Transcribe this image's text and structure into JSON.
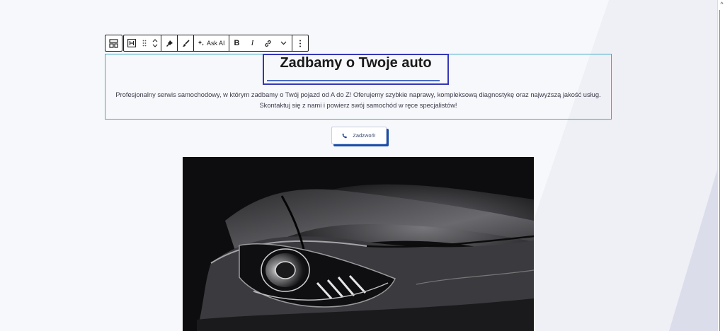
{
  "toolbar": {
    "parent_icon": "block-parent-icon",
    "items": [
      {
        "name": "heading-block-icon",
        "label": "H"
      },
      {
        "name": "drag-handle-icon",
        "label": "⠿"
      },
      {
        "name": "move-up-down-icon",
        "label": "⌃⌄"
      },
      {
        "name": "pin-icon",
        "label": ""
      },
      {
        "name": "brush-icon",
        "label": ""
      },
      {
        "name": "ai-sparkle-icon",
        "label": "Ask AI"
      },
      {
        "name": "bold-icon",
        "label": "B"
      },
      {
        "name": "italic-icon",
        "label": "I"
      },
      {
        "name": "link-icon",
        "label": ""
      },
      {
        "name": "chevron-down-icon",
        "label": ""
      },
      {
        "name": "more-options-icon",
        "label": ""
      }
    ],
    "ask_ai_label": "Ask AI",
    "bold_label": "B",
    "italic_label": "I"
  },
  "hero": {
    "title": "Zadbamy o Twoje auto",
    "description_line1": "Profesjonalny serwis samochodowy, w którym zadbamy o Twój pojazd od A do Z! Oferujemy szybkie naprawy, kompleksową diagnostykę oraz najwyższą jakość usług.",
    "description_line2": "Skontaktuj się z nami i powierz swój samochód w ręce specjalistów!",
    "button_label": "Zadzwoń!",
    "button_icon": "phone-icon"
  },
  "colors": {
    "selection_border": "#3fa9c5",
    "heading_highlight": "#3437b8",
    "button_shadow": "#1b4fa8",
    "scrollbar_accent": "#27b8a9"
  },
  "image": {
    "subject": "car-headlight-photo"
  }
}
